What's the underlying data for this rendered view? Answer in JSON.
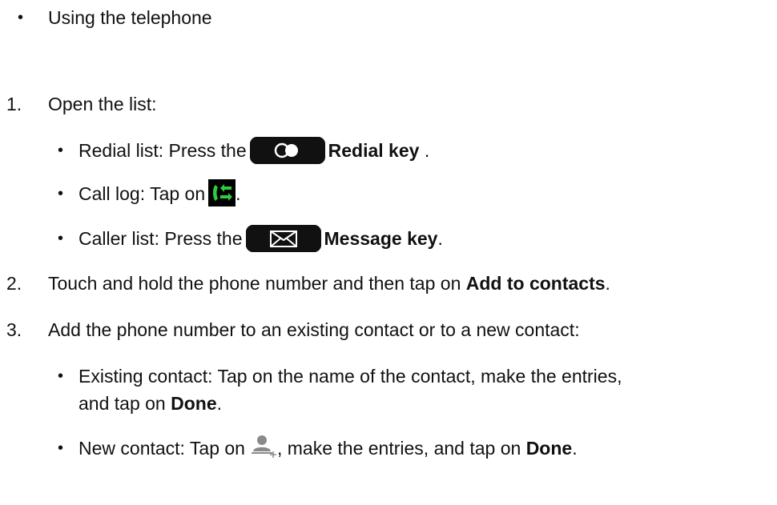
{
  "intro": {
    "bullet": "•",
    "text": "Using the telephone"
  },
  "steps": [
    {
      "number": "1.",
      "text": "Open the list:",
      "subitems": [
        {
          "bullet": "•",
          "prefix": "Redial list: Press the",
          "icon": "redial-key-icon",
          "bold": "Redial key",
          "suffix": "."
        },
        {
          "bullet": "•",
          "prefix": "Call log: Tap on",
          "icon": "call-log-icon",
          "suffix": "."
        },
        {
          "bullet": "•",
          "prefix": "Caller list: Press the",
          "icon": "message-key-icon",
          "bold": "Message key",
          "suffix": "."
        }
      ]
    },
    {
      "number": "2.",
      "prefix": "Touch and hold the phone number and then tap on",
      "bold": "Add to contacts",
      "suffix": "."
    },
    {
      "number": "3.",
      "text": "Add the phone number to an existing contact or to a new contact:",
      "subitems": [
        {
          "bullet": "•",
          "line1": "Existing contact: Tap on the name of the contact, make the entries,",
          "line2_prefix": "and tap on",
          "bold": "Done",
          "suffix": "."
        },
        {
          "bullet": "•",
          "prefix": "New contact: Tap on",
          "icon": "add-person-icon",
          "middle": ", make the entries, and tap on",
          "bold": "Done",
          "suffix": "."
        }
      ]
    }
  ]
}
